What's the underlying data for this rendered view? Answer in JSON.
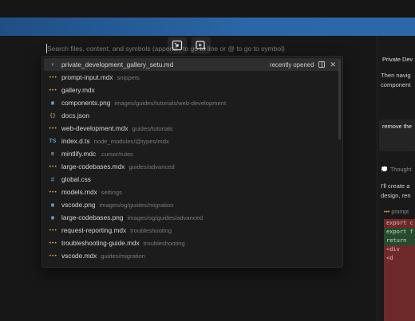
{
  "search": {
    "placeholder": "Search files, content, and symbols (append : to go to line or @ to go to symbol)"
  },
  "controls": {
    "left_icon": "exit-fullscreen-icon",
    "right_icon": "play-sparkle-icon"
  },
  "files": [
    {
      "icon": "md-icon",
      "glyph": "⬇",
      "name": "private_development_gallery_setu.md",
      "path": "",
      "selected": true
    },
    {
      "icon": "mdx-icon",
      "glyph": "•••",
      "name": "prompt-input.mdx",
      "path": "snippets"
    },
    {
      "icon": "mdx-icon",
      "glyph": "•••",
      "name": "gallery.mdx",
      "path": ""
    },
    {
      "icon": "image-icon",
      "glyph": "▣",
      "name": "components.png",
      "path": "images/guides/tutorials/web-development"
    },
    {
      "icon": "json-icon",
      "glyph": "{}",
      "name": "docs.json",
      "path": ""
    },
    {
      "icon": "mdx-icon",
      "glyph": "•••",
      "name": "web-development.mdx",
      "path": "guides/tutorials"
    },
    {
      "icon": "ts-icon",
      "glyph": "TS",
      "name": "index.d.ts",
      "path": "node_modules/@types/mdx"
    },
    {
      "icon": "mdc-icon",
      "glyph": "≡",
      "name": "mintlify.mdc",
      "path": ".cursor/rules"
    },
    {
      "icon": "mdx-icon",
      "glyph": "•••",
      "name": "large-codebases.mdx",
      "path": "guides/advanced"
    },
    {
      "icon": "css-icon",
      "glyph": "#",
      "name": "global.css",
      "path": ""
    },
    {
      "icon": "mdx-icon",
      "glyph": "•••",
      "name": "models.mdx",
      "path": "settings"
    },
    {
      "icon": "image-icon",
      "glyph": "▣",
      "name": "vscode.png",
      "path": "images/og/guides/migration"
    },
    {
      "icon": "image-icon",
      "glyph": "▣",
      "name": "large-codebases.png",
      "path": "images/og/guides/advanced"
    },
    {
      "icon": "mdx-icon",
      "glyph": "•••",
      "name": "request-reporting.mdx",
      "path": "troubleshooting"
    },
    {
      "icon": "mdx-icon",
      "glyph": "•••",
      "name": "troubleshooting-guide.mdx",
      "path": "troubleshooting"
    },
    {
      "icon": "mdx-icon",
      "glyph": "•••",
      "name": "vscode.mdx",
      "path": "guides/migration"
    }
  ],
  "selected_meta": {
    "recent_label": "recently opened",
    "split_icon": "split-view-icon",
    "close_icon": "close-icon"
  },
  "right_panel": {
    "title": "Private Dev",
    "text1_line1": "Then navig",
    "text1_line2": "component",
    "box_text": "remove the",
    "thought_label": "Thought",
    "text2_line1": "I'll create a",
    "text2_line2": "design, ren",
    "code_filename": "prompt",
    "code_lines": [
      {
        "kind": "del",
        "text": "export c"
      },
      {
        "kind": "add",
        "text": "export f"
      },
      {
        "kind": "add",
        "text": "  return"
      },
      {
        "kind": "del",
        "text": "    <div"
      },
      {
        "kind": "del",
        "text": "      <d"
      }
    ]
  }
}
